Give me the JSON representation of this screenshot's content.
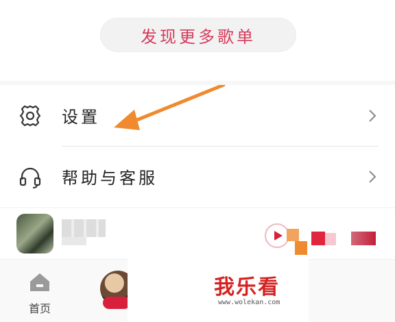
{
  "discover_button": {
    "label": "发现更多歌单"
  },
  "menu": {
    "items": [
      {
        "label": "设置",
        "icon": "gear-icon"
      },
      {
        "label": "帮助与客服",
        "icon": "headset-icon"
      }
    ]
  },
  "annotation": {
    "arrow_color": "#f08a2e"
  },
  "tabbar": {
    "home_label": "首页"
  },
  "watermark": {
    "text": "我乐看",
    "url": "www.wolekan.com"
  },
  "colors": {
    "accent": "#d43c5c",
    "arrow": "#f08a2e",
    "watermark": "#d42222"
  }
}
